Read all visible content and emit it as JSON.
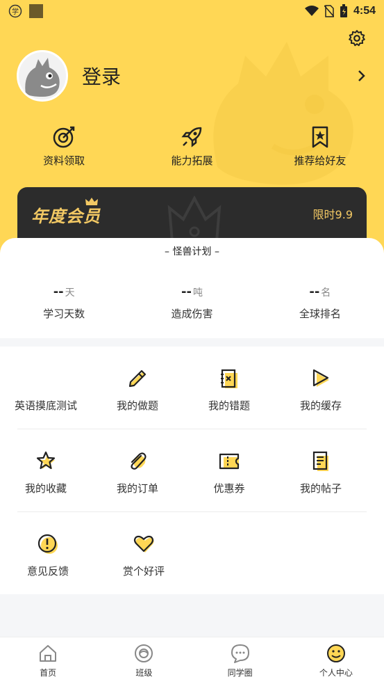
{
  "status_bar": {
    "time": "4:54",
    "left_icons": [
      "learn-icon",
      "app-square-icon"
    ],
    "right_icons": [
      "wifi-icon",
      "no-sim-icon",
      "battery-icon"
    ]
  },
  "profile": {
    "login_label": "登录"
  },
  "quick_actions": [
    {
      "label": "资料领取",
      "icon": "target-icon"
    },
    {
      "label": "能力拓展",
      "icon": "rocket-icon"
    },
    {
      "label": "推荐给好友",
      "icon": "bookmark-star-icon"
    }
  ],
  "vip": {
    "title": "年度会员",
    "price": "限时9.9"
  },
  "stats": {
    "header": "怪兽计划",
    "items": [
      {
        "value": "--",
        "unit": "天",
        "label": "学习天数"
      },
      {
        "value": "--",
        "unit": "吨",
        "label": "造成伤害"
      },
      {
        "value": "--",
        "unit": "名",
        "label": "全球排名"
      }
    ]
  },
  "menu": {
    "row1": [
      {
        "label": "英语摸底测试",
        "icon": ""
      },
      {
        "label": "我的做题",
        "icon": "pencil-icon"
      },
      {
        "label": "我的错题",
        "icon": "wrong-notebook-icon"
      },
      {
        "label": "我的缓存",
        "icon": "play-icon"
      }
    ],
    "row2": [
      {
        "label": "我的收藏",
        "icon": "star-icon"
      },
      {
        "label": "我的订单",
        "icon": "paperclip-icon"
      },
      {
        "label": "优惠券",
        "icon": "coupon-icon"
      },
      {
        "label": "我的帖子",
        "icon": "document-icon"
      }
    ],
    "row3": [
      {
        "label": "意见反馈",
        "icon": "exclamation-icon"
      },
      {
        "label": "赏个好评",
        "icon": "heart-icon"
      }
    ]
  },
  "tabbar": [
    {
      "label": "首页",
      "icon": "home-icon",
      "active": false
    },
    {
      "label": "班级",
      "icon": "class-icon",
      "active": false
    },
    {
      "label": "同学圈",
      "icon": "chat-icon",
      "active": false
    },
    {
      "label": "个人中心",
      "icon": "smile-face-icon",
      "active": true
    }
  ],
  "colors": {
    "accent": "#ffd755",
    "vip_gold": "#f3c964",
    "vip_bg": "#2c2c2c"
  }
}
